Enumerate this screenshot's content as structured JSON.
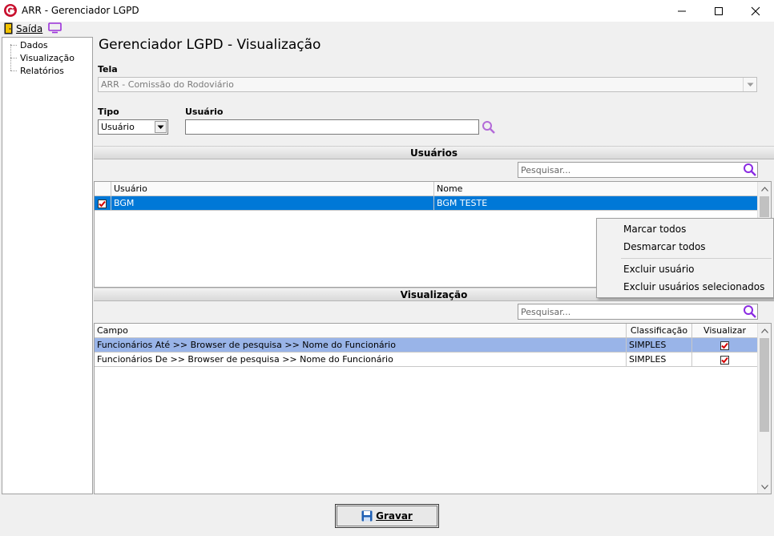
{
  "window": {
    "title": "ARR - Gerenciador LGPD",
    "controls": {
      "minimize": "minimize-icon",
      "maximize": "maximize-icon",
      "close": "close-icon"
    }
  },
  "toolbar": {
    "exit_label": "Saída",
    "exit_icon": "exit-door-icon",
    "screen_icon": "monitor-icon"
  },
  "tree": {
    "items": [
      {
        "label": "Dados"
      },
      {
        "label": "Visualização"
      },
      {
        "label": "Relatórios"
      }
    ]
  },
  "main": {
    "title": "Gerenciador LGPD - Visualização",
    "tela": {
      "label": "Tela",
      "value": "ARR - Comissão do Rodoviário"
    },
    "tipo": {
      "label": "Tipo",
      "value": "Usuário"
    },
    "usuario": {
      "label": "Usuário",
      "value": ""
    }
  },
  "usuarios_section": {
    "header": "Usuários",
    "search_placeholder": "Pesquisar...",
    "columns": [
      "Usuário",
      "Nome"
    ],
    "rows": [
      {
        "checked": true,
        "usuario": "BGM",
        "nome": "BGM TESTE",
        "selected": true
      }
    ]
  },
  "context_menu": {
    "items": [
      "Marcar todos",
      "Desmarcar todos",
      "Excluir usuário",
      "Excluir usuários selecionados"
    ]
  },
  "visualizacao_section": {
    "header": "Visualização",
    "search_placeholder": "Pesquisar...",
    "columns": [
      "Campo",
      "Classificação",
      "Visualizar"
    ],
    "rows": [
      {
        "campo": "Funcionários Até >> Browser de pesquisa >> Nome do Funcionário",
        "classificacao": "SIMPLES",
        "visualizar": true,
        "selected": true
      },
      {
        "campo": "Funcionários De >> Browser de pesquisa >> Nome do Funcionário",
        "classificacao": "SIMPLES",
        "visualizar": true,
        "selected": false
      }
    ]
  },
  "save_button": {
    "label": "Gravar",
    "icon": "floppy-disk-icon"
  },
  "colors": {
    "selection_blue": "#0078d7",
    "selection_lightblue": "#99b4e8",
    "accent_purple": "#8a2be2",
    "check_red": "#d40000"
  }
}
